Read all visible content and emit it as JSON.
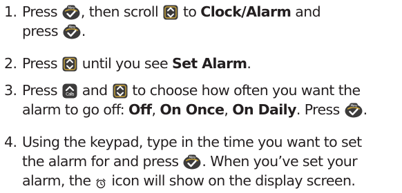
{
  "colors": {
    "key_dark": "#3c3b3b",
    "key_gold": "#cba53a",
    "text": "#231f20"
  },
  "icons": {
    "menu_key": "menu-ok-key-icon",
    "scroll_key": "scroll-key-icon",
    "calls_key": "calls-key-icon",
    "alarm": "alarm-clock-icon"
  },
  "menu_key_label": "Menu",
  "calls_key_label": "Calls",
  "steps": [
    {
      "num": "1.",
      "t1": "Press",
      "t2": ", then scroll",
      "t3": "to",
      "b1": "Clock/Alarm",
      "t4": "and",
      "t5": "press",
      "t6": "."
    },
    {
      "num": "2.",
      "t1": "Press",
      "t2": "until you see",
      "b1": "Set Alarm",
      "t3": "."
    },
    {
      "num": "3.",
      "t1": "Press",
      "t2": "and",
      "t3": "to choose how often you want the",
      "t4": "alarm to go off:",
      "b1": "Off",
      "t5": ",",
      "b2": "On Once",
      "t6": ",",
      "b3": "On Daily",
      "t7": ". Press",
      "t8": "."
    },
    {
      "num": "4.",
      "t1": "Using the keypad, type in the time you want to set",
      "t2": "the alarm for and press",
      "t3": ". When you’ve set your",
      "t4": "alarm, the",
      "t5": "icon will show on the display screen."
    }
  ]
}
